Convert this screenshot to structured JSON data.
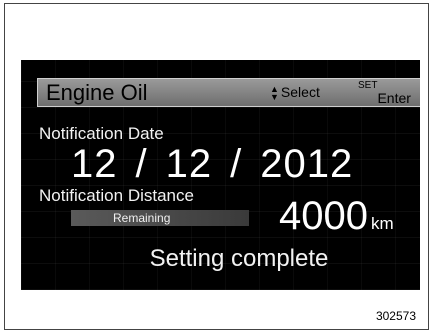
{
  "header": {
    "title": "Engine Oil",
    "select_label": "Select",
    "set_label": "SET",
    "enter_label": "Enter"
  },
  "notification_date": {
    "label": "Notification Date",
    "month": "12",
    "day": "12",
    "year": "2012",
    "separator": "/"
  },
  "notification_distance": {
    "label": "Notification Distance",
    "remaining_label": "Remaining",
    "value": "4000",
    "unit": "km"
  },
  "status": "Setting complete",
  "figure_id": "302573",
  "colors": {
    "screen_bg": "#000000",
    "header_bg": "#8a8a8a",
    "text": "#ffffff"
  }
}
